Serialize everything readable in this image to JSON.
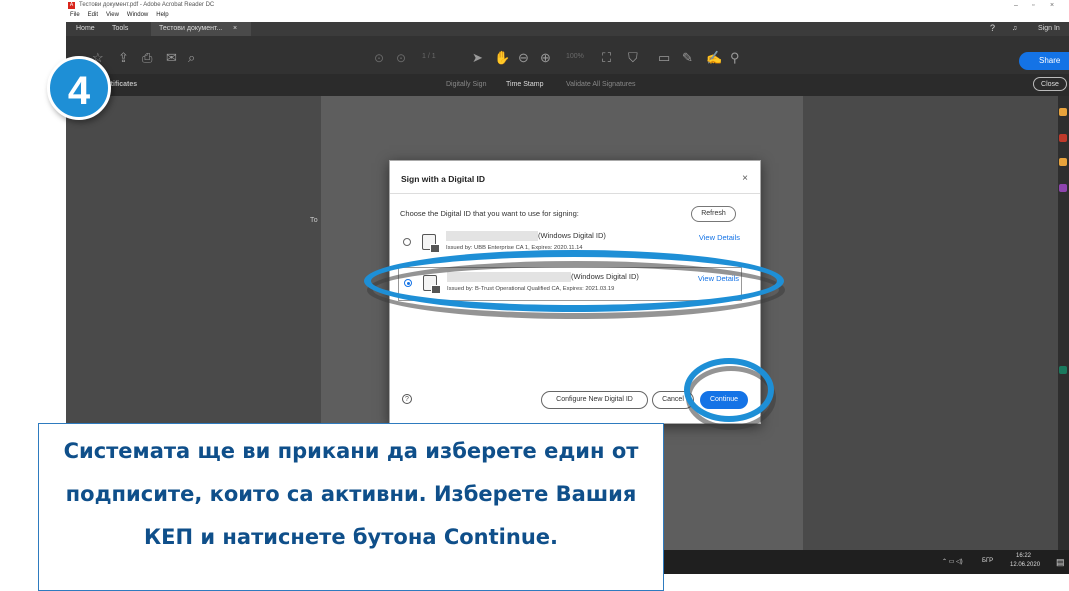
{
  "window": {
    "title": "Тестови документ.pdf - Adobe Acrobat Reader DC",
    "pdf_icon": "pdf-icon",
    "controls": [
      "–",
      "▫",
      "×"
    ]
  },
  "menu": [
    "File",
    "Edit",
    "View",
    "Window",
    "Help"
  ],
  "tabs": {
    "home": "Home",
    "tools": "Tools",
    "document": "Тестови документ...",
    "document_close": "×",
    "sign_in": "Sign In"
  },
  "toolbar": {
    "page_indicator": "1 / 1",
    "zoom": "100%",
    "share_label": "Share"
  },
  "certbar": {
    "label": "Certificates",
    "digitally_sign": "Digitally Sign",
    "time_stamp": "Time Stamp",
    "validate": "Validate All Signatures",
    "close": "Close"
  },
  "page": {
    "text": "То"
  },
  "step_badge": "4",
  "dialog": {
    "title": "Sign with a Digital ID",
    "close": "×",
    "prompt": "Choose the Digital ID that you want to use for signing:",
    "refresh": "Refresh",
    "ids": [
      {
        "name_suffix": "(Windows Digital ID)",
        "issuer": "Issued by: UBB Enterprise CA 1, Expires: 2020.11.14",
        "view_details": "View Details",
        "selected": false
      },
      {
        "name_suffix": "(Windows Digital ID)",
        "issuer": "Issued by: B-Trust Operational Qualified CA, Expires: 2021.03.19",
        "view_details": "View Details",
        "selected": true
      }
    ],
    "help": "?",
    "configure": "Configure New Digital ID",
    "cancel": "Cancel",
    "continue": "Continue"
  },
  "taskbar": {
    "language": "БГР",
    "time": "16:22",
    "date": "12.06.2020"
  },
  "caption": "Системата ще ви прикани да изберете един от подписите, които са активни. Изберете Вашия КЕП и натиснете бутона Continue.",
  "colors": {
    "highlight": "#1e8fd6",
    "accent": "#1473e6",
    "caption_text": "#0f4f8a"
  }
}
